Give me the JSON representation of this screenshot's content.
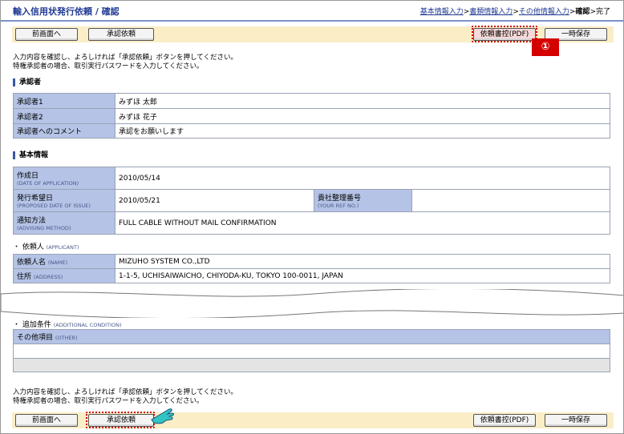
{
  "header": {
    "title": "輸入信用状発行依頼 / 確認",
    "steps": [
      {
        "label": "基本情報入力",
        "link": true
      },
      {
        "label": "書類情報入力",
        "link": true
      },
      {
        "label": "その他情報入力",
        "link": true
      },
      {
        "label": "確認",
        "link": false,
        "current": true
      },
      {
        "label": "完了",
        "link": false
      }
    ],
    "step_separator": ">"
  },
  "toolbar": {
    "back_label": "前画面へ",
    "approve_label": "承認依頼",
    "pdf_label": "依頼書控(PDF)",
    "temp_save_label": "一時保存"
  },
  "badge": "①",
  "message": {
    "line1": "入力内容を確認し、よろしければ「承認依頼」ボタンを押してください。",
    "line2": "特権承認者の場合、取引実行パスワードを入力してください。"
  },
  "approvers": {
    "heading": "承認者",
    "rows": [
      {
        "label": "承認者1",
        "value": "みずほ 太郎"
      },
      {
        "label": "承認者2",
        "value": "みずほ 花子"
      },
      {
        "label": "承認者へのコメント",
        "value": "承認をお願いします"
      }
    ]
  },
  "basic": {
    "heading": "基本情報",
    "created_label": "作成日",
    "created_en": "(DATE OF APPLICATION)",
    "created_value": "2010/05/14",
    "issue_label": "発行希望日",
    "issue_en": "(PROPOSED DATE OF ISSUE)",
    "issue_value": "2010/05/21",
    "ref_label": "貴社整理番号",
    "ref_en": "(YOUR REF NO.)",
    "ref_value": "",
    "advise_label": "通知方法",
    "advise_en": "(ADVISING METHOD)",
    "advise_value": "FULL CABLE WITHOUT MAIL CONFIRMATION"
  },
  "applicant": {
    "heading": "・ 依頼人",
    "heading_en": "(APPLICANT)",
    "name_label": "依頼人名",
    "name_en": "(NAME)",
    "name_value": "MIZUHO SYSTEM CO.,LTD",
    "addr_label": "住所",
    "addr_en": "(ADDRESS)",
    "addr_value": "1-1-5, UCHISAIWAICHO, CHIYODA-KU, TOKYO 100-0011, JAPAN"
  },
  "additional": {
    "heading": "・ 追加条件",
    "heading_en": "(ADDITIONAL CONDITION)",
    "other_label": "その他項目",
    "other_en": "(OTHER)",
    "other_value": ""
  },
  "colors": {
    "label_bg": "#b4c3e6",
    "toolbar_bg": "#fbeec6",
    "highlight": "#cc0000",
    "title": "#1f3a93"
  }
}
